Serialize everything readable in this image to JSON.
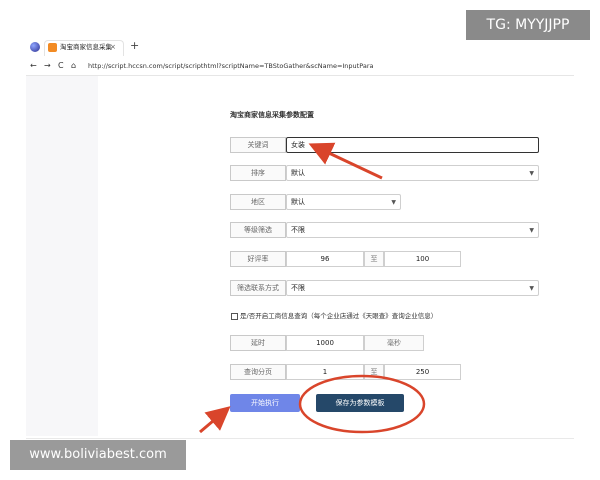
{
  "browser": {
    "tab_title": "淘宝商家信息采集",
    "tab_close": "×",
    "new_tab": "+",
    "nav": {
      "back": "←",
      "forward": "→",
      "reload": "C",
      "home": "⌂"
    },
    "url": "http://script.hccsn.com/script/scripthtml?scriptName=TBStoGather&scName=InputPara"
  },
  "form": {
    "title": "淘宝商家信息采集参数配置",
    "keyword": {
      "label": "关键词",
      "value": "女装"
    },
    "sort": {
      "label": "排序",
      "value": "默认"
    },
    "region": {
      "label": "地区",
      "value": "默认"
    },
    "level": {
      "label": "等级筛选",
      "value": "不限"
    },
    "rating": {
      "label": "好评率",
      "from": "96",
      "sep": "至",
      "to": "100"
    },
    "contact": {
      "label": "筛选联系方式",
      "value": "不限"
    },
    "business_check": {
      "label": "是/否开启工商信息查询（每个企业店通过《天眼查》查询企业信息）",
      "checked": false
    },
    "delay": {
      "label": "延时",
      "value": "1000",
      "unit": "毫秒"
    },
    "paging": {
      "label": "查询分页",
      "from": "1",
      "sep": "至",
      "to": "250"
    },
    "start_button": "开始执行",
    "save_button": "保存为参数模板"
  },
  "overlay": {
    "watermark": "TG: MYYJJPP",
    "site": "www.boliviabest.com",
    "annotation_color": "#d9452b"
  }
}
